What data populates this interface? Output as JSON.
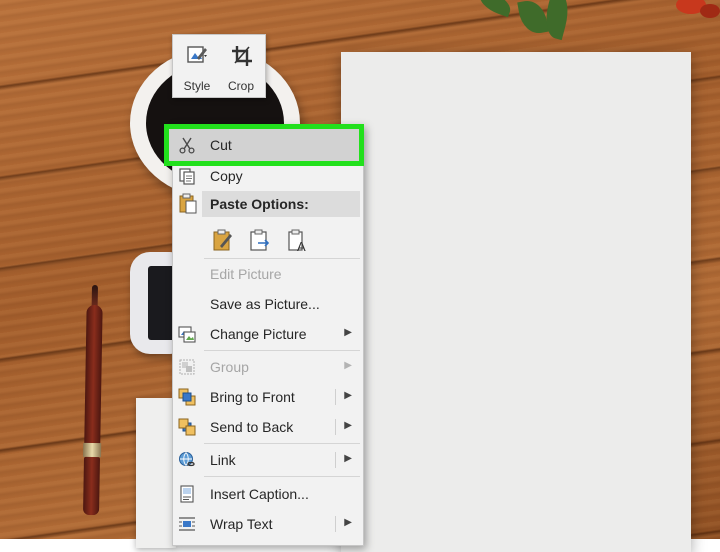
{
  "minibar": {
    "style_label": "Style",
    "crop_label": "Crop"
  },
  "menu": {
    "cut": "Cut",
    "copy": "Copy",
    "paste_options_header": "Paste Options:",
    "edit_picture": "Edit Picture",
    "save_as_picture": "Save as Picture...",
    "change_picture": "Change Picture",
    "group": "Group",
    "bring_to_front": "Bring to Front",
    "send_to_back": "Send to Back",
    "link": "Link",
    "insert_caption": "Insert Caption...",
    "wrap_text": "Wrap Text"
  },
  "icons": {
    "cut": "scissors-icon",
    "copy": "copy-icon",
    "paste": "clipboard-icon",
    "paste_keep_formatting": "paste-keep-formatting-icon",
    "paste_picture": "paste-picture-icon",
    "paste_text_only": "paste-text-only-icon",
    "change_picture": "change-picture-icon",
    "group": "group-icon",
    "bring_to_front": "bring-to-front-icon",
    "send_to_back": "send-to-back-icon",
    "link": "link-icon",
    "insert_caption": "caption-icon",
    "wrap_text": "wrap-text-icon",
    "style": "style-icon",
    "crop": "crop-icon",
    "submenu": "chevron-right-icon"
  },
  "colors": {
    "highlight": "#22e01c",
    "menu_bg": "#f2f2f2"
  }
}
